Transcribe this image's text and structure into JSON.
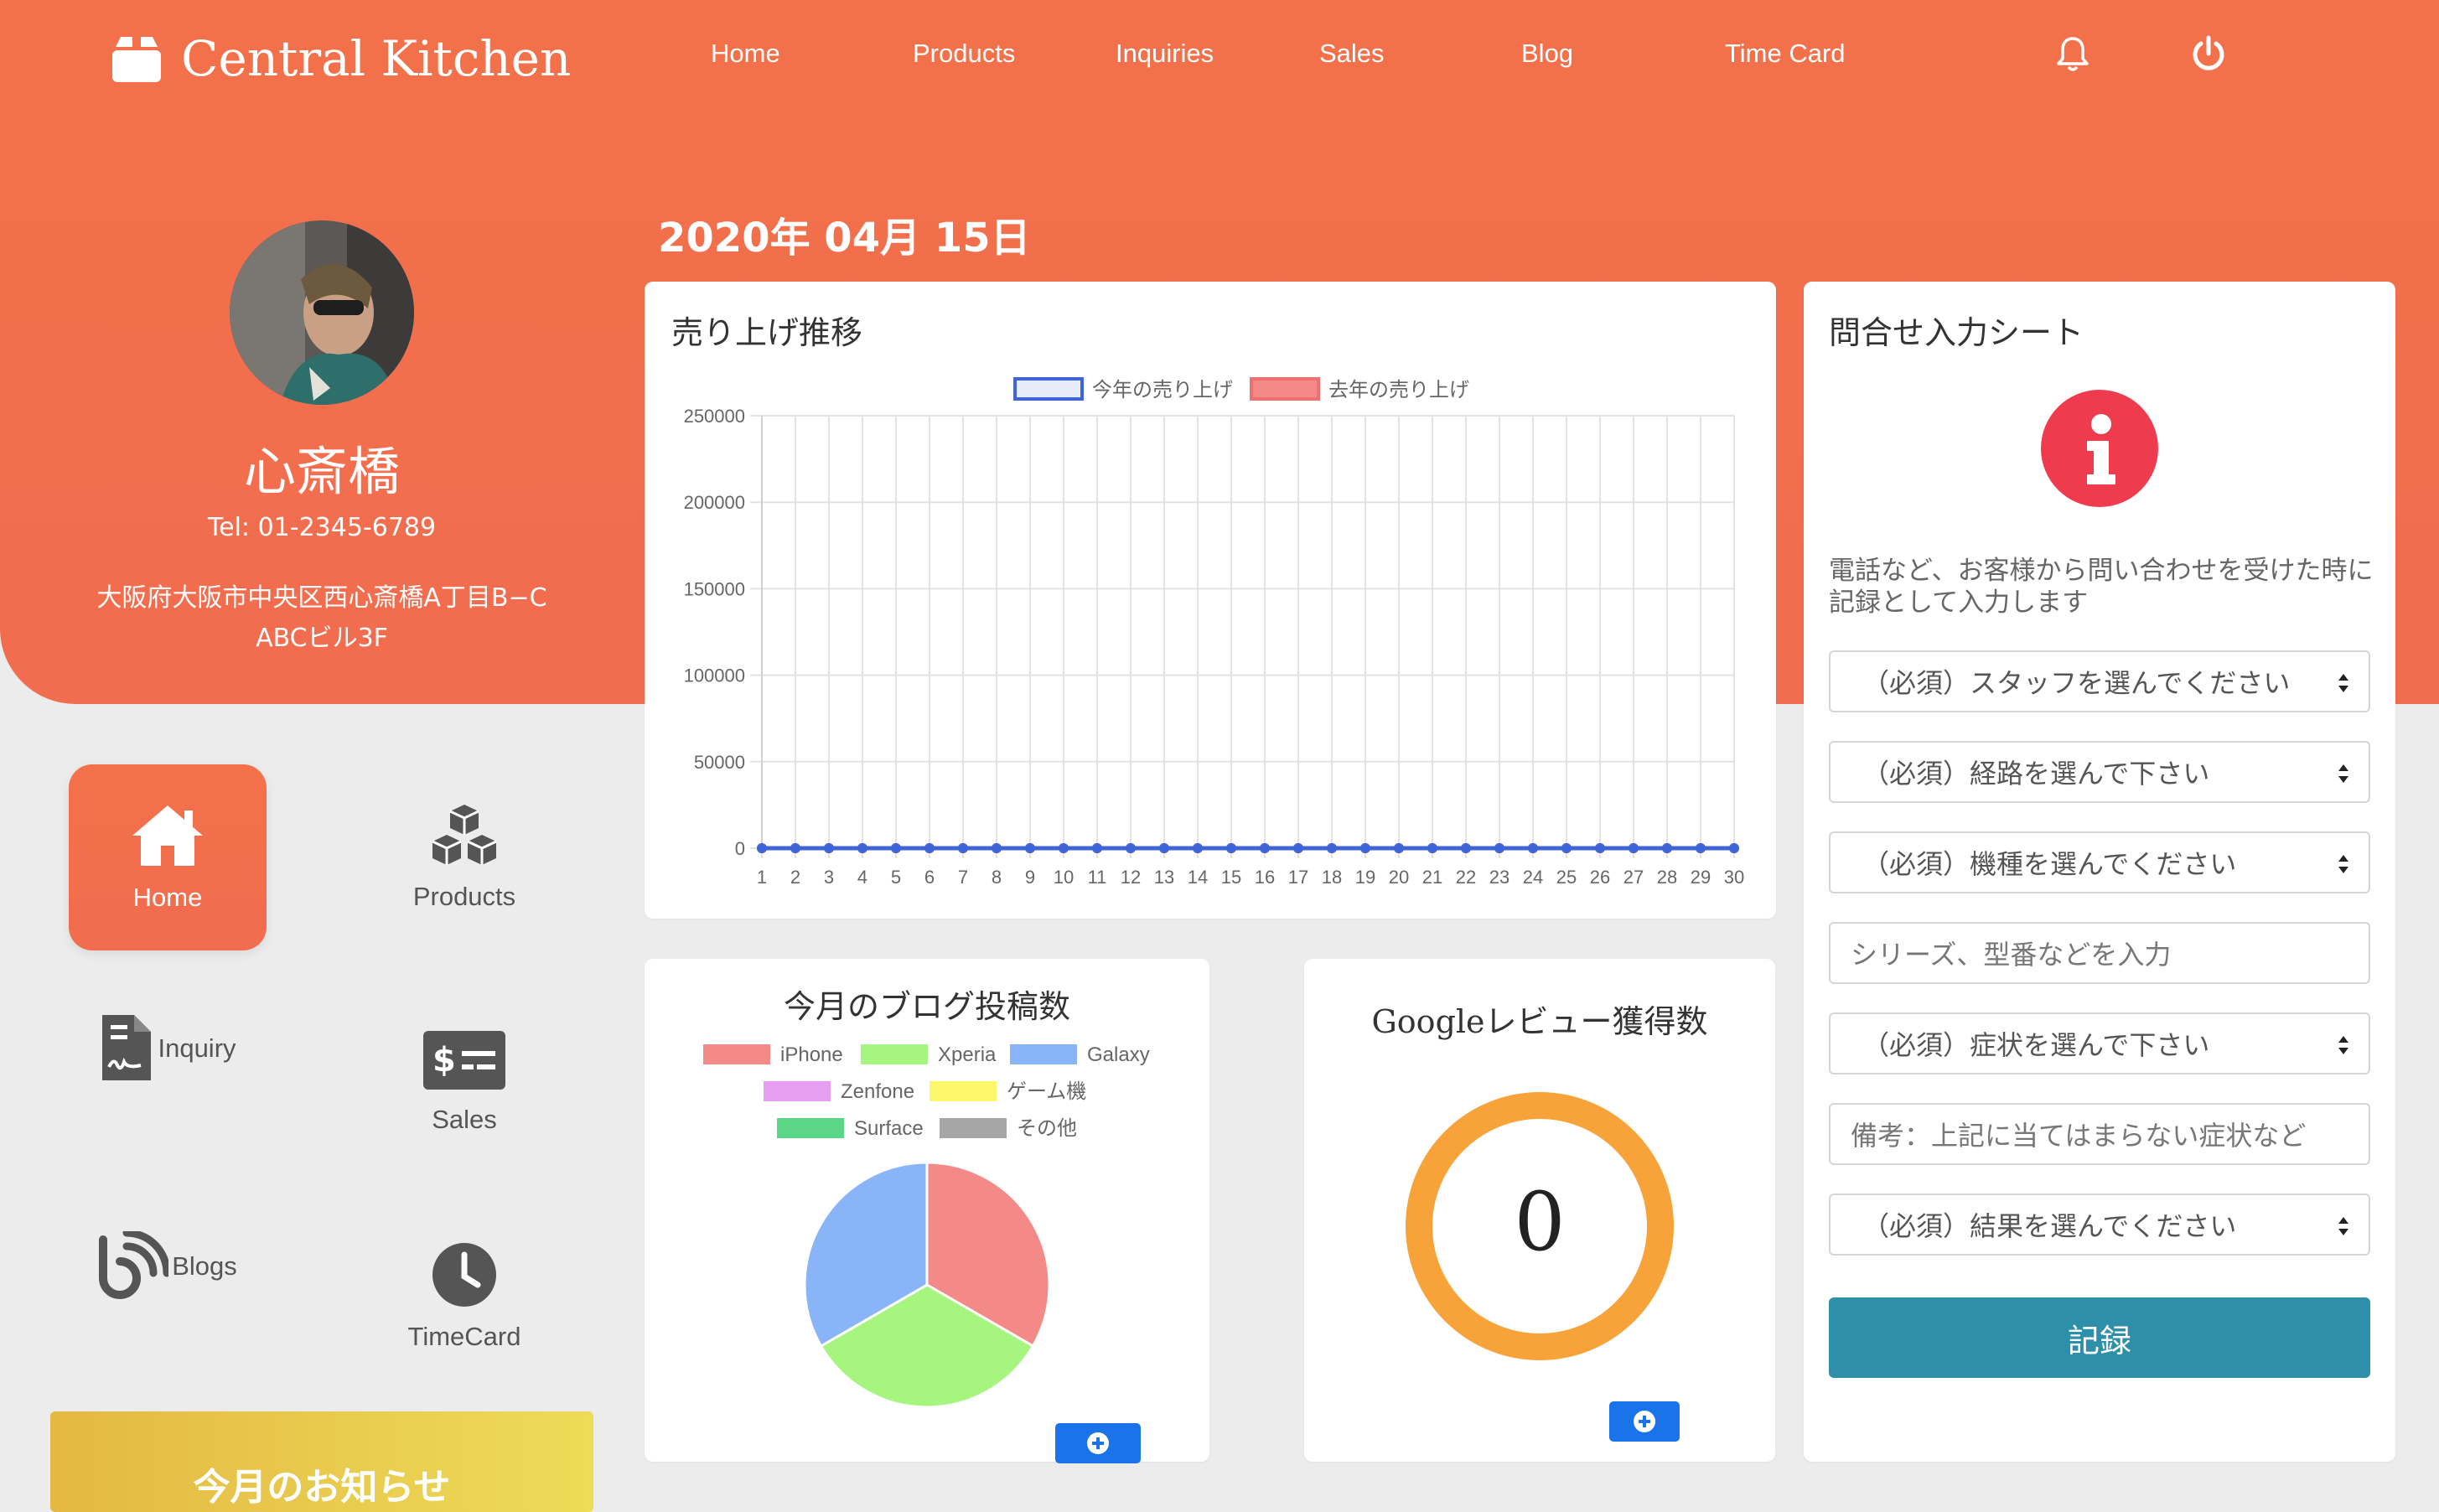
{
  "header": {
    "brand": "Central Kitchen",
    "brand_icon": "box-icon",
    "nav": [
      "Home",
      "Products",
      "Inquiries",
      "Sales",
      "Blog",
      "Time Card"
    ],
    "icons": [
      "bell-icon",
      "power-icon"
    ]
  },
  "date": "2020年 04月 15日",
  "store": {
    "name": "心斎橋",
    "tel": "Tel: 01-2345-6789",
    "address_line1": "大阪府大阪市中央区西心斎橋A丁目B−C",
    "address_line2": "ABCビル3F"
  },
  "menu": [
    {
      "label": "Home",
      "icon": "home-icon",
      "active": true
    },
    {
      "label": "Products",
      "icon": "cubes-icon",
      "active": false
    },
    {
      "label": "Inquiry",
      "icon": "file-signature-icon",
      "active": false
    },
    {
      "label": "Sales",
      "icon": "dollar-sign-icon",
      "active": false
    },
    {
      "label": "Blogs",
      "icon": "blog-icon",
      "active": false
    },
    {
      "label": "TimeCard",
      "icon": "clock-icon",
      "active": false
    }
  ],
  "notice": "今月のお知らせ",
  "colors": {
    "accent": "#f26f4b",
    "blue": "#1a73e8",
    "submit": "#2e8fab",
    "info": "#ef3b4e",
    "donut": "#f7a33a"
  },
  "sales_card": {
    "title": "売り上げ推移"
  },
  "blog_card": {
    "title": "今月のブログ投稿数"
  },
  "review_card": {
    "title": "Googleレビュー獲得数",
    "value": "0"
  },
  "chart_data": [
    {
      "type": "line",
      "title": "売り上げ推移",
      "x": [
        1,
        2,
        3,
        4,
        5,
        6,
        7,
        8,
        9,
        10,
        11,
        12,
        13,
        14,
        15,
        16,
        17,
        18,
        19,
        20,
        21,
        22,
        23,
        24,
        25,
        26,
        27,
        28,
        29,
        30
      ],
      "series": [
        {
          "name": "今年の売り上げ",
          "color": "#3d64d8",
          "values": [
            0,
            0,
            0,
            0,
            0,
            0,
            0,
            0,
            0,
            0,
            0,
            0,
            0,
            0,
            0,
            0,
            0,
            0,
            0,
            0,
            0,
            0,
            0,
            0,
            0,
            0,
            0,
            0,
            0,
            0
          ]
        },
        {
          "name": "去年の売り上げ",
          "color": "#f07070",
          "values": [
            0,
            0,
            0,
            0,
            0,
            0,
            0,
            0,
            0,
            0,
            0,
            0,
            0,
            0,
            0,
            0,
            0,
            0,
            0,
            0,
            0,
            0,
            0,
            0,
            0,
            0,
            0,
            0,
            0,
            0
          ]
        }
      ],
      "ylim": [
        0,
        250000
      ],
      "yticks": [
        0,
        50000,
        100000,
        150000,
        200000,
        250000
      ],
      "grid": true,
      "legend": "top"
    },
    {
      "type": "pie",
      "title": "今月のブログ投稿数",
      "categories": [
        "iPhone",
        "Xperia",
        "Galaxy",
        "Zenfone",
        "ゲーム機",
        "Surface",
        "その他"
      ],
      "colors": [
        "#f48a87",
        "#a6f57e",
        "#8ab4f8",
        "#e79df2",
        "#fdf86b",
        "#5ad687",
        "#a6a6a6"
      ],
      "values": [
        1,
        1,
        1,
        0,
        0,
        0,
        0
      ],
      "legend": "top"
    },
    {
      "type": "pie",
      "title": "Googleレビュー獲得数",
      "categories": [],
      "values": [
        0
      ],
      "legend": "none"
    }
  ],
  "form": {
    "title": "問合せ入力シート",
    "description": "電話など、お客様から問い合わせを受けた時に記録として入力します",
    "icon": "info-circle-icon",
    "fields": [
      {
        "type": "select",
        "value": "（必須）スタッフを選んでください"
      },
      {
        "type": "select",
        "value": "（必須）経路を選んで下さい"
      },
      {
        "type": "select",
        "value": "（必須）機種を選んでください"
      },
      {
        "type": "input",
        "placeholder": "シリーズ、型番などを入力"
      },
      {
        "type": "select",
        "value": "（必須）症状を選んで下さい"
      },
      {
        "type": "input",
        "placeholder": "備考：上記に当てはまらない症状など"
      },
      {
        "type": "select",
        "value": "（必須）結果を選んでください"
      }
    ],
    "submit": "記録"
  }
}
